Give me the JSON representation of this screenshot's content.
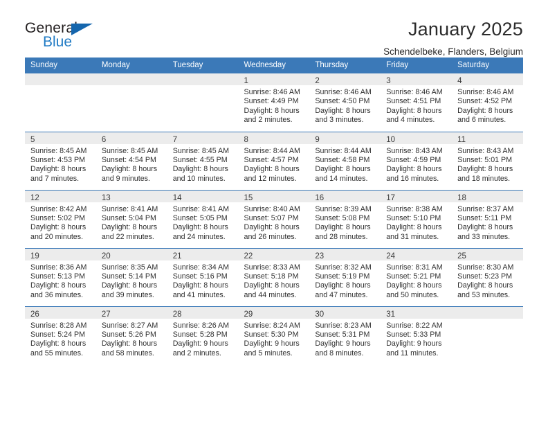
{
  "brand": {
    "name_part1": "General",
    "name_part2": "Blue",
    "triangle_color": "#1566ad",
    "blue_color": "#1f7ac4"
  },
  "header": {
    "title": "January 2025",
    "subtitle": "Schendelbeke, Flanders, Belgium",
    "header_bg_color": "#3b79b8",
    "band_color": "#ececec"
  },
  "weekdays": [
    "Sunday",
    "Monday",
    "Tuesday",
    "Wednesday",
    "Thursday",
    "Friday",
    "Saturday"
  ],
  "weeks": [
    [
      {
        "day": "",
        "sunrise": "",
        "sunset": "",
        "daylight1": "",
        "daylight2": ""
      },
      {
        "day": "",
        "sunrise": "",
        "sunset": "",
        "daylight1": "",
        "daylight2": ""
      },
      {
        "day": "",
        "sunrise": "",
        "sunset": "",
        "daylight1": "",
        "daylight2": ""
      },
      {
        "day": "1",
        "sunrise": "Sunrise: 8:46 AM",
        "sunset": "Sunset: 4:49 PM",
        "daylight1": "Daylight: 8 hours",
        "daylight2": "and 2 minutes."
      },
      {
        "day": "2",
        "sunrise": "Sunrise: 8:46 AM",
        "sunset": "Sunset: 4:50 PM",
        "daylight1": "Daylight: 8 hours",
        "daylight2": "and 3 minutes."
      },
      {
        "day": "3",
        "sunrise": "Sunrise: 8:46 AM",
        "sunset": "Sunset: 4:51 PM",
        "daylight1": "Daylight: 8 hours",
        "daylight2": "and 4 minutes."
      },
      {
        "day": "4",
        "sunrise": "Sunrise: 8:46 AM",
        "sunset": "Sunset: 4:52 PM",
        "daylight1": "Daylight: 8 hours",
        "daylight2": "and 6 minutes."
      }
    ],
    [
      {
        "day": "5",
        "sunrise": "Sunrise: 8:45 AM",
        "sunset": "Sunset: 4:53 PM",
        "daylight1": "Daylight: 8 hours",
        "daylight2": "and 7 minutes."
      },
      {
        "day": "6",
        "sunrise": "Sunrise: 8:45 AM",
        "sunset": "Sunset: 4:54 PM",
        "daylight1": "Daylight: 8 hours",
        "daylight2": "and 9 minutes."
      },
      {
        "day": "7",
        "sunrise": "Sunrise: 8:45 AM",
        "sunset": "Sunset: 4:55 PM",
        "daylight1": "Daylight: 8 hours",
        "daylight2": "and 10 minutes."
      },
      {
        "day": "8",
        "sunrise": "Sunrise: 8:44 AM",
        "sunset": "Sunset: 4:57 PM",
        "daylight1": "Daylight: 8 hours",
        "daylight2": "and 12 minutes."
      },
      {
        "day": "9",
        "sunrise": "Sunrise: 8:44 AM",
        "sunset": "Sunset: 4:58 PM",
        "daylight1": "Daylight: 8 hours",
        "daylight2": "and 14 minutes."
      },
      {
        "day": "10",
        "sunrise": "Sunrise: 8:43 AM",
        "sunset": "Sunset: 4:59 PM",
        "daylight1": "Daylight: 8 hours",
        "daylight2": "and 16 minutes."
      },
      {
        "day": "11",
        "sunrise": "Sunrise: 8:43 AM",
        "sunset": "Sunset: 5:01 PM",
        "daylight1": "Daylight: 8 hours",
        "daylight2": "and 18 minutes."
      }
    ],
    [
      {
        "day": "12",
        "sunrise": "Sunrise: 8:42 AM",
        "sunset": "Sunset: 5:02 PM",
        "daylight1": "Daylight: 8 hours",
        "daylight2": "and 20 minutes."
      },
      {
        "day": "13",
        "sunrise": "Sunrise: 8:41 AM",
        "sunset": "Sunset: 5:04 PM",
        "daylight1": "Daylight: 8 hours",
        "daylight2": "and 22 minutes."
      },
      {
        "day": "14",
        "sunrise": "Sunrise: 8:41 AM",
        "sunset": "Sunset: 5:05 PM",
        "daylight1": "Daylight: 8 hours",
        "daylight2": "and 24 minutes."
      },
      {
        "day": "15",
        "sunrise": "Sunrise: 8:40 AM",
        "sunset": "Sunset: 5:07 PM",
        "daylight1": "Daylight: 8 hours",
        "daylight2": "and 26 minutes."
      },
      {
        "day": "16",
        "sunrise": "Sunrise: 8:39 AM",
        "sunset": "Sunset: 5:08 PM",
        "daylight1": "Daylight: 8 hours",
        "daylight2": "and 28 minutes."
      },
      {
        "day": "17",
        "sunrise": "Sunrise: 8:38 AM",
        "sunset": "Sunset: 5:10 PM",
        "daylight1": "Daylight: 8 hours",
        "daylight2": "and 31 minutes."
      },
      {
        "day": "18",
        "sunrise": "Sunrise: 8:37 AM",
        "sunset": "Sunset: 5:11 PM",
        "daylight1": "Daylight: 8 hours",
        "daylight2": "and 33 minutes."
      }
    ],
    [
      {
        "day": "19",
        "sunrise": "Sunrise: 8:36 AM",
        "sunset": "Sunset: 5:13 PM",
        "daylight1": "Daylight: 8 hours",
        "daylight2": "and 36 minutes."
      },
      {
        "day": "20",
        "sunrise": "Sunrise: 8:35 AM",
        "sunset": "Sunset: 5:14 PM",
        "daylight1": "Daylight: 8 hours",
        "daylight2": "and 39 minutes."
      },
      {
        "day": "21",
        "sunrise": "Sunrise: 8:34 AM",
        "sunset": "Sunset: 5:16 PM",
        "daylight1": "Daylight: 8 hours",
        "daylight2": "and 41 minutes."
      },
      {
        "day": "22",
        "sunrise": "Sunrise: 8:33 AM",
        "sunset": "Sunset: 5:18 PM",
        "daylight1": "Daylight: 8 hours",
        "daylight2": "and 44 minutes."
      },
      {
        "day": "23",
        "sunrise": "Sunrise: 8:32 AM",
        "sunset": "Sunset: 5:19 PM",
        "daylight1": "Daylight: 8 hours",
        "daylight2": "and 47 minutes."
      },
      {
        "day": "24",
        "sunrise": "Sunrise: 8:31 AM",
        "sunset": "Sunset: 5:21 PM",
        "daylight1": "Daylight: 8 hours",
        "daylight2": "and 50 minutes."
      },
      {
        "day": "25",
        "sunrise": "Sunrise: 8:30 AM",
        "sunset": "Sunset: 5:23 PM",
        "daylight1": "Daylight: 8 hours",
        "daylight2": "and 53 minutes."
      }
    ],
    [
      {
        "day": "26",
        "sunrise": "Sunrise: 8:28 AM",
        "sunset": "Sunset: 5:24 PM",
        "daylight1": "Daylight: 8 hours",
        "daylight2": "and 55 minutes."
      },
      {
        "day": "27",
        "sunrise": "Sunrise: 8:27 AM",
        "sunset": "Sunset: 5:26 PM",
        "daylight1": "Daylight: 8 hours",
        "daylight2": "and 58 minutes."
      },
      {
        "day": "28",
        "sunrise": "Sunrise: 8:26 AM",
        "sunset": "Sunset: 5:28 PM",
        "daylight1": "Daylight: 9 hours",
        "daylight2": "and 2 minutes."
      },
      {
        "day": "29",
        "sunrise": "Sunrise: 8:24 AM",
        "sunset": "Sunset: 5:30 PM",
        "daylight1": "Daylight: 9 hours",
        "daylight2": "and 5 minutes."
      },
      {
        "day": "30",
        "sunrise": "Sunrise: 8:23 AM",
        "sunset": "Sunset: 5:31 PM",
        "daylight1": "Daylight: 9 hours",
        "daylight2": "and 8 minutes."
      },
      {
        "day": "31",
        "sunrise": "Sunrise: 8:22 AM",
        "sunset": "Sunset: 5:33 PM",
        "daylight1": "Daylight: 9 hours",
        "daylight2": "and 11 minutes."
      },
      {
        "day": "",
        "sunrise": "",
        "sunset": "",
        "daylight1": "",
        "daylight2": ""
      }
    ]
  ]
}
